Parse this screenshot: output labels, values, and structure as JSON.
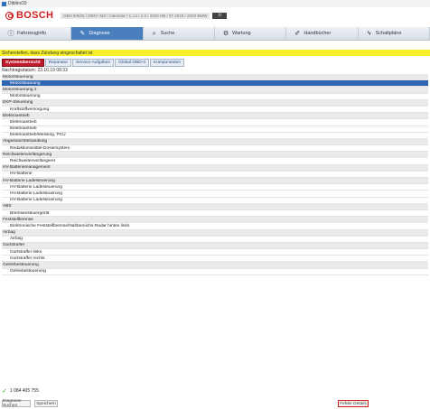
{
  "window": {
    "title": "Diblinx33"
  },
  "header": {
    "brand": "BOSCH",
    "version": "DBN 9/9/25 / DBN / M3 / Calendar / C.14 / 2.0 / 2024 HB / 07 2019 / 2020 BMW",
    "badge": "Ⓐ"
  },
  "nav": {
    "tabs": [
      {
        "label": "Fahrzeuginfo",
        "icon": "info-icon"
      },
      {
        "label": "Diagnose",
        "icon": "wrench-icon"
      },
      {
        "label": "Suche",
        "icon": "search-icon"
      },
      {
        "label": "Wartung",
        "icon": "gears-icon"
      },
      {
        "label": "Handbücher",
        "icon": "book-icon"
      },
      {
        "label": "Schaltpläne",
        "icon": "circuit-icon"
      }
    ]
  },
  "notice": {
    "text": "Sicherstellen, dass Zündung eingeschaltet ist"
  },
  "subtabs": [
    "Systemübersicht",
    "Reparatur",
    "Service-Aufgaben",
    "Global OBD-II",
    "Komponenten"
  ],
  "date": "Nachtragsdatum: 23.10.19  08:33",
  "rows": [
    {
      "type": "group",
      "label": "Motorsteuerung"
    },
    {
      "type": "item",
      "label": "Motorsteuerung",
      "selected": true
    },
    {
      "type": "group",
      "label": "Motorsteuerung 2"
    },
    {
      "type": "item",
      "label": "Motorsteuerung"
    },
    {
      "type": "group",
      "label": "EKP-Steuerung"
    },
    {
      "type": "item",
      "label": "Kraftstoffversorgung"
    },
    {
      "type": "group",
      "label": "Elektroantrieb"
    },
    {
      "type": "item",
      "label": "Elektroantrieb"
    },
    {
      "type": "item",
      "label": "Elektroantrieb"
    },
    {
      "type": "item",
      "label": "Elektroantrieb/Messing, PCU"
    },
    {
      "type": "group",
      "label": "Abgasnachbehandlung"
    },
    {
      "type": "item",
      "label": "Reduktionsmittel-Dosiersystem"
    },
    {
      "type": "group",
      "label": "Reichweitenverlängerung"
    },
    {
      "type": "item",
      "label": "Reichweitenverlängerer"
    },
    {
      "type": "group",
      "label": "HV-Batteriemanagement"
    },
    {
      "type": "item",
      "label": "HV-Batterie"
    },
    {
      "type": "group",
      "label": "HV-Batterie Ladesteuerung"
    },
    {
      "type": "item",
      "label": "HV-Batterie Ladesteuerung"
    },
    {
      "type": "item",
      "label": "HV-Batterie Ladesteuerung"
    },
    {
      "type": "item",
      "label": "HV-Batterie Ladesteuerung"
    },
    {
      "type": "group",
      "label": "ABS"
    },
    {
      "type": "item",
      "label": "Bremsensteuergerät"
    },
    {
      "type": "group",
      "label": "Feststellbremse"
    },
    {
      "type": "item",
      "label": "Elektronische Feststellbremse/Nahbereichs-Radar hinten links"
    },
    {
      "type": "group",
      "label": "Airbag"
    },
    {
      "type": "item",
      "label": "Airbag"
    },
    {
      "type": "group",
      "label": "Gurtstraffer"
    },
    {
      "type": "item",
      "label": "Gurtstraffer links"
    },
    {
      "type": "item",
      "label": "Gurtstraffer rechts"
    },
    {
      "type": "group",
      "label": "Getriebesteuerung"
    },
    {
      "type": "item",
      "label": "Getriebesteuerung"
    }
  ],
  "phone": "1 084 405 755",
  "footer": {
    "left1": "Diagnose-Suchen",
    "left2": "Speichern",
    "right": "Fehler Details"
  },
  "colors": {
    "brand": "#d21f1f",
    "accent": "#2f66b2",
    "notice": "#f7ef2a",
    "subtab_active": "#c21c2c"
  }
}
